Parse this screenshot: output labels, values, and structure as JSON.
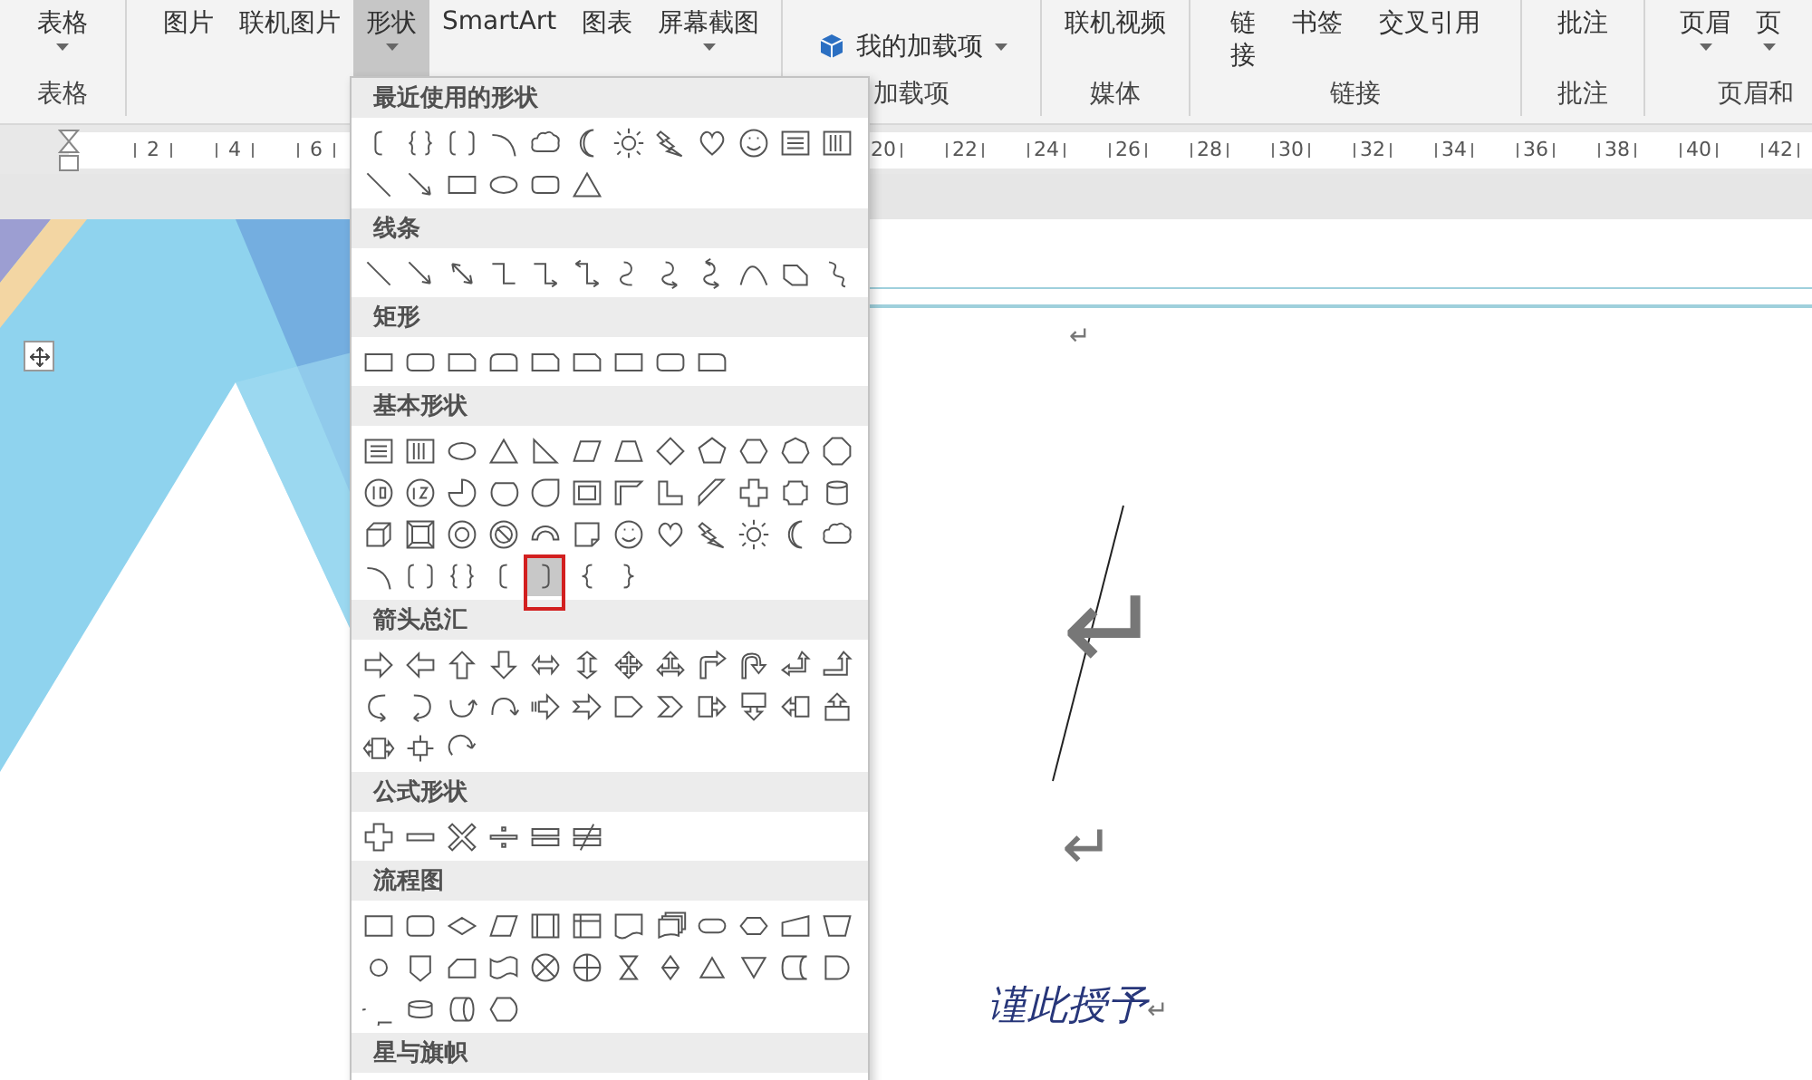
{
  "ribbon": {
    "groups": [
      {
        "label": "表格",
        "buttons": [
          {
            "label": "表格",
            "kind": "large",
            "dropdown": true,
            "selected": false
          }
        ]
      },
      {
        "buttons": [
          {
            "label": "图片",
            "kind": "large",
            "dropdown": false,
            "selected": false
          },
          {
            "label": "联机图片",
            "kind": "large",
            "dropdown": false,
            "selected": false
          },
          {
            "label": "形状",
            "kind": "large",
            "dropdown": true,
            "selected": true
          },
          {
            "label": "SmartArt",
            "kind": "large",
            "dropdown": false,
            "selected": false
          },
          {
            "label": "图表",
            "kind": "large",
            "dropdown": false,
            "selected": false
          },
          {
            "label": "屏幕截图",
            "kind": "large",
            "dropdown": true,
            "selected": false
          }
        ]
      },
      {
        "label": "加载项",
        "buttons": [
          {
            "label": "我的加载项",
            "kind": "menu",
            "dropdown": true,
            "selected": false
          }
        ]
      },
      {
        "label": "媒体",
        "buttons": [
          {
            "label": "联机视频",
            "kind": "large",
            "dropdown": false,
            "selected": false
          }
        ]
      },
      {
        "label": "链接",
        "buttons": [
          {
            "label": "链接",
            "kind": "stacked",
            "dropdown": false,
            "selected": false
          },
          {
            "label": "书签",
            "kind": "large",
            "dropdown": false,
            "selected": false
          },
          {
            "label": "交叉引用",
            "kind": "large",
            "dropdown": false,
            "selected": false
          }
        ]
      },
      {
        "label": "批注",
        "buttons": [
          {
            "label": "批注",
            "kind": "large",
            "dropdown": false,
            "selected": false
          }
        ]
      },
      {
        "label": "页眉和",
        "buttons": [
          {
            "label": "页眉",
            "kind": "large",
            "dropdown": true,
            "selected": false
          },
          {
            "label": "页",
            "kind": "large",
            "dropdown": true,
            "selected": false
          }
        ]
      }
    ]
  },
  "ruler": {
    "left_labels": [
      "2",
      "4",
      "6"
    ],
    "right_labels": [
      "20",
      "22",
      "24",
      "26",
      "28",
      "30",
      "32",
      "34",
      "36",
      "38",
      "40",
      "42"
    ]
  },
  "shapes_menu": {
    "sections": [
      {
        "title": "最近使用的形状",
        "shapes": [
          {
            "kind": "left-bracket",
            "selected": false
          },
          {
            "kind": "brace-pair",
            "selected": false
          },
          {
            "kind": "bracket-pair",
            "selected": false
          },
          {
            "kind": "arc",
            "selected": false
          },
          {
            "kind": "cloud",
            "selected": false
          },
          {
            "kind": "moon",
            "selected": false
          },
          {
            "kind": "sun",
            "selected": false
          },
          {
            "kind": "lightning",
            "selected": false
          },
          {
            "kind": "heart",
            "selected": false
          },
          {
            "kind": "smiley",
            "selected": false
          },
          {
            "kind": "textbox",
            "selected": false
          },
          {
            "kind": "vtextbox",
            "selected": false
          },
          {
            "kind": "line",
            "selected": false
          },
          {
            "kind": "arrow-line",
            "selected": false
          },
          {
            "kind": "rect",
            "selected": false
          },
          {
            "kind": "ellipse",
            "selected": false
          },
          {
            "kind": "rounded-rect",
            "selected": false
          },
          {
            "kind": "triangle",
            "selected": false
          }
        ]
      },
      {
        "title": "线条",
        "shapes": [
          {
            "kind": "line",
            "selected": false
          },
          {
            "kind": "arrow-line",
            "selected": false
          },
          {
            "kind": "double-arrow",
            "selected": false
          },
          {
            "kind": "elbow",
            "selected": false
          },
          {
            "kind": "elbow-arrow",
            "selected": false
          },
          {
            "kind": "elbow-double",
            "selected": false
          },
          {
            "kind": "curve",
            "selected": false
          },
          {
            "kind": "curve-arrow",
            "selected": false
          },
          {
            "kind": "curve-double",
            "selected": false
          },
          {
            "kind": "freeform-curve",
            "selected": false
          },
          {
            "kind": "freeform",
            "selected": false
          },
          {
            "kind": "scribble",
            "selected": false
          }
        ]
      },
      {
        "title": "矩形",
        "shapes": [
          {
            "kind": "rect",
            "selected": false
          },
          {
            "kind": "rounded-rect",
            "selected": false
          },
          {
            "kind": "snip-rect",
            "selected": false
          },
          {
            "kind": "round-top-rect",
            "selected": false
          },
          {
            "kind": "snip-rect",
            "selected": false
          },
          {
            "kind": "snip-rect",
            "selected": false
          },
          {
            "kind": "rect",
            "selected": false
          },
          {
            "kind": "rounded-rect",
            "selected": false
          },
          {
            "kind": "round-corner-rect",
            "selected": false
          }
        ]
      },
      {
        "title": "基本形状",
        "shapes": [
          {
            "kind": "textbox",
            "selected": false
          },
          {
            "kind": "vtextbox",
            "selected": false
          },
          {
            "kind": "ellipse",
            "selected": false
          },
          {
            "kind": "triangle",
            "selected": false
          },
          {
            "kind": "right-triangle",
            "selected": false
          },
          {
            "kind": "parallelogram",
            "selected": false
          },
          {
            "kind": "trapezoid",
            "selected": false
          },
          {
            "kind": "diamond",
            "selected": false
          },
          {
            "kind": "pentagon",
            "selected": false
          },
          {
            "kind": "hexagon",
            "selected": false
          },
          {
            "kind": "heptagon",
            "selected": false
          },
          {
            "kind": "octagon",
            "selected": false
          },
          {
            "kind": "decagon",
            "selected": false
          },
          {
            "kind": "dodecagon",
            "selected": false
          },
          {
            "kind": "pie",
            "selected": false
          },
          {
            "kind": "chord",
            "selected": false
          },
          {
            "kind": "teardrop",
            "selected": false
          },
          {
            "kind": "frame",
            "selected": false
          },
          {
            "kind": "half-frame",
            "selected": false
          },
          {
            "kind": "l-shape",
            "selected": false
          },
          {
            "kind": "stripe",
            "selected": false
          },
          {
            "kind": "cross",
            "selected": false
          },
          {
            "kind": "plaque",
            "selected": false
          },
          {
            "kind": "can",
            "selected": false
          },
          {
            "kind": "cube",
            "selected": false
          },
          {
            "kind": "bevel",
            "selected": false
          },
          {
            "kind": "donut",
            "selected": false
          },
          {
            "kind": "no-symbol",
            "selected": false
          },
          {
            "kind": "block-arc",
            "selected": false
          },
          {
            "kind": "folded-corner",
            "selected": false
          },
          {
            "kind": "smiley",
            "selected": false
          },
          {
            "kind": "heart",
            "selected": false
          },
          {
            "kind": "lightning",
            "selected": false
          },
          {
            "kind": "sun",
            "selected": false
          },
          {
            "kind": "moon",
            "selected": false
          },
          {
            "kind": "cloud",
            "selected": false
          },
          {
            "kind": "arc",
            "selected": false
          },
          {
            "kind": "bracket-pair",
            "selected": false
          },
          {
            "kind": "brace-pair",
            "selected": false
          },
          {
            "kind": "left-bracket",
            "selected": false
          },
          {
            "kind": "right-bracket",
            "selected": true
          },
          {
            "kind": "left-brace",
            "selected": false
          },
          {
            "kind": "right-brace",
            "selected": false
          }
        ]
      },
      {
        "title": "箭头总汇",
        "shapes": [
          {
            "kind": "arrow-right",
            "selected": false
          },
          {
            "kind": "arrow-left",
            "selected": false
          },
          {
            "kind": "arrow-up",
            "selected": false
          },
          {
            "kind": "arrow-down",
            "selected": false
          },
          {
            "kind": "arrow-left-right",
            "selected": false
          },
          {
            "kind": "arrow-up-down",
            "selected": false
          },
          {
            "kind": "arrow-quad",
            "selected": false
          },
          {
            "kind": "arrow-left-right-up",
            "selected": false
          },
          {
            "kind": "arrow-bent",
            "selected": false
          },
          {
            "kind": "arrow-u-turn",
            "selected": false
          },
          {
            "kind": "arrow-left-up",
            "selected": false
          },
          {
            "kind": "arrow-bent-up",
            "selected": false
          },
          {
            "kind": "curved-right",
            "selected": false
          },
          {
            "kind": "curved-left",
            "selected": false
          },
          {
            "kind": "curved-up",
            "selected": false
          },
          {
            "kind": "curved-down",
            "selected": false
          },
          {
            "kind": "striped-arrow",
            "selected": false
          },
          {
            "kind": "notched-arrow",
            "selected": false
          },
          {
            "kind": "pentagon-arrow",
            "selected": false
          },
          {
            "kind": "chevron",
            "selected": false
          },
          {
            "kind": "callout-right",
            "selected": false
          },
          {
            "kind": "callout-down",
            "selected": false
          },
          {
            "kind": "callout-left",
            "selected": false
          },
          {
            "kind": "callout-up",
            "selected": false
          },
          {
            "kind": "callout-left-right",
            "selected": false
          },
          {
            "kind": "callout-quad",
            "selected": false
          },
          {
            "kind": "circular-arrow",
            "selected": false
          }
        ]
      },
      {
        "title": "公式形状",
        "shapes": [
          {
            "kind": "plus",
            "selected": false
          },
          {
            "kind": "minus",
            "selected": false
          },
          {
            "kind": "multiply",
            "selected": false
          },
          {
            "kind": "divide",
            "selected": false
          },
          {
            "kind": "equal",
            "selected": false
          },
          {
            "kind": "not-equal",
            "selected": false
          }
        ]
      },
      {
        "title": "流程图",
        "shapes": [
          {
            "kind": "flow-process",
            "selected": false
          },
          {
            "kind": "flow-alternate",
            "selected": false
          },
          {
            "kind": "flow-decision",
            "selected": false
          },
          {
            "kind": "flow-data",
            "selected": false
          },
          {
            "kind": "flow-predefined",
            "selected": false
          },
          {
            "kind": "flow-internal",
            "selected": false
          },
          {
            "kind": "flow-document",
            "selected": false
          },
          {
            "kind": "flow-multidoc",
            "selected": false
          },
          {
            "kind": "flow-terminator",
            "selected": false
          },
          {
            "kind": "flow-preparation",
            "selected": false
          },
          {
            "kind": "flow-manual-input",
            "selected": false
          },
          {
            "kind": "flow-manual-op",
            "selected": false
          },
          {
            "kind": "flow-connector",
            "selected": false
          },
          {
            "kind": "flow-offpage",
            "selected": false
          },
          {
            "kind": "flow-card",
            "selected": false
          },
          {
            "kind": "flow-tape",
            "selected": false
          },
          {
            "kind": "flow-summing",
            "selected": false
          },
          {
            "kind": "flow-or",
            "selected": false
          },
          {
            "kind": "flow-collate",
            "selected": false
          },
          {
            "kind": "flow-sort",
            "selected": false
          },
          {
            "kind": "flow-extract",
            "selected": false
          },
          {
            "kind": "flow-merge",
            "selected": false
          },
          {
            "kind": "flow-stored",
            "selected": false
          },
          {
            "kind": "flow-delay",
            "selected": false
          },
          {
            "kind": "flow-sequential",
            "selected": false
          },
          {
            "kind": "flow-disk",
            "selected": false
          },
          {
            "kind": "flow-direct",
            "selected": false
          },
          {
            "kind": "flow-display",
            "selected": false
          }
        ]
      },
      {
        "title": "星与旗帜"
      }
    ]
  },
  "document": {
    "paragraphs": [
      {
        "kind": "small",
        "mark": "↵"
      },
      {
        "kind": "large",
        "mark": "↵"
      },
      {
        "kind": "medium",
        "mark": "↵"
      },
      {
        "kind": "signature",
        "text": "谨此授予",
        "mark": "↵"
      }
    ]
  }
}
